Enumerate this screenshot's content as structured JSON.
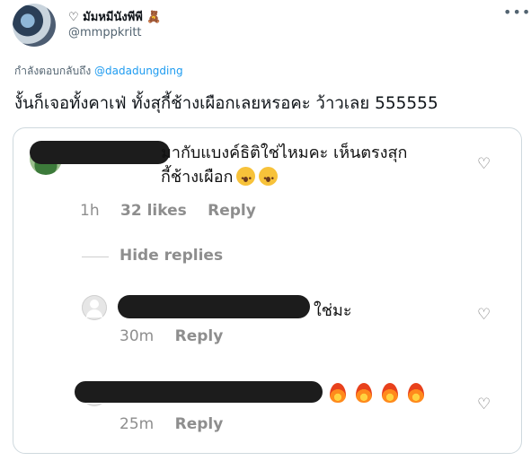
{
  "tweet": {
    "display_name": "♡ มัมหมีนังพีพี 🧸",
    "handle": "@mmppkritt",
    "more_icon": "more-horizontal-icon",
    "reply_prefix": "กำลังตอบกลับถึง",
    "reply_to": "@dadadungding",
    "text": "งั้นก็เจอทั้งคาเฟ่ ทั้งสุกี้ช้างเผือกเลยหรอคะ ว้าวเลย 555555"
  },
  "comments": {
    "c1": {
      "text_line1": "มากับแบงค์ธิติใช่ไหมคะ เห็นตรงสุก",
      "text_line2": "กี้ช้างเผือก",
      "time": "1h",
      "likes": "32 likes",
      "reply": "Reply"
    },
    "hide_replies": "Hide replies",
    "c2": {
      "text": "ใช่มะ",
      "time": "30m",
      "reply": "Reply"
    },
    "c3": {
      "time": "25m",
      "reply": "Reply"
    }
  }
}
